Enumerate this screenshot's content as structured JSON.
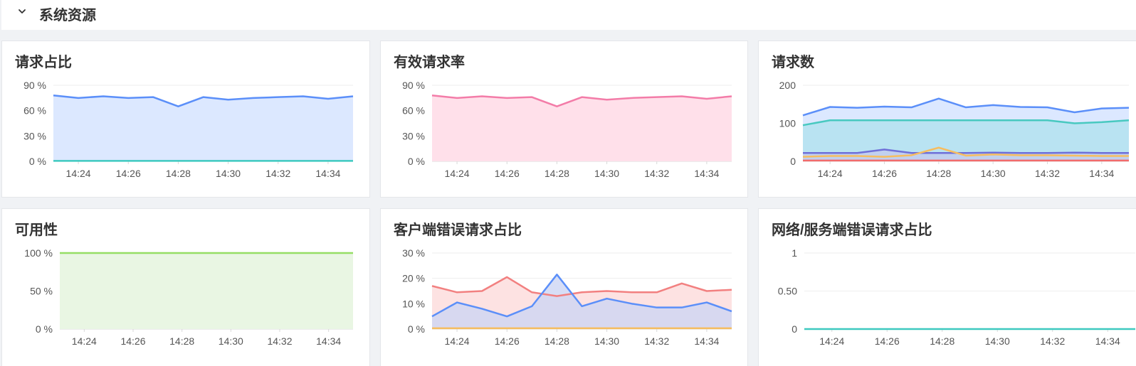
{
  "section": {
    "title": "系统资源"
  },
  "x_ticks": [
    "14:24",
    "14:26",
    "14:28",
    "14:30",
    "14:32",
    "14:34"
  ],
  "chart_data": [
    {
      "type": "area",
      "title": "请求占比",
      "y_ticks": [
        "90 %",
        "60 %",
        "30 %",
        "0 %"
      ],
      "ylim": [
        0,
        90
      ],
      "series": [
        {
          "color": "#5b8ff9",
          "fill": "#dce8ff",
          "fill_opacity": 1,
          "values": [
            78,
            75,
            77,
            75,
            76,
            65,
            76,
            73,
            75,
            76,
            77,
            74,
            77
          ]
        },
        {
          "color": "#3ec9c0",
          "fill": null,
          "values": [
            0.5,
            0.5,
            0.5,
            0.5,
            0.5,
            0.5,
            0.5,
            0.5,
            0.5,
            0.5,
            0.5,
            0.5,
            0.5
          ]
        }
      ]
    },
    {
      "type": "area",
      "title": "有效请求率",
      "y_ticks": [
        "90 %",
        "60 %",
        "30 %",
        "0 %"
      ],
      "ylim": [
        0,
        90
      ],
      "series": [
        {
          "color": "#f37ca8",
          "fill": "#ffe0ea",
          "fill_opacity": 1,
          "values": [
            78,
            75,
            77,
            75,
            76,
            65,
            76,
            73,
            75,
            76,
            77,
            74,
            77
          ]
        }
      ]
    },
    {
      "type": "area",
      "title": "请求数",
      "y_ticks": [
        "200",
        "100",
        "0"
      ],
      "ylim": [
        0,
        200
      ],
      "series": [
        {
          "color": "#5b8ff9",
          "fill": "#dce8ff",
          "fill_opacity": 1,
          "values": [
            121,
            143,
            141,
            144,
            142,
            165,
            142,
            148,
            143,
            142,
            129,
            139,
            141
          ]
        },
        {
          "color": "#48c9c0",
          "fill": "#b9e3f2",
          "fill_opacity": 1,
          "values": [
            95,
            108,
            108,
            108,
            108,
            108,
            108,
            108,
            108,
            108,
            100,
            103,
            108
          ]
        },
        {
          "color": "#6f6fd8",
          "fill": "#c4c8ee",
          "fill_opacity": 0.7,
          "values": [
            22,
            22,
            22,
            31,
            22,
            22,
            22,
            23,
            22,
            22,
            23,
            22,
            22
          ]
        },
        {
          "color": "#f6bd60",
          "fill": null,
          "values": [
            12,
            14,
            14,
            12,
            16,
            36,
            15,
            18,
            16,
            16,
            15,
            14,
            14
          ]
        },
        {
          "color": "#f26b6b",
          "fill": null,
          "values": [
            2,
            2,
            2,
            2,
            2,
            2,
            2,
            2,
            2,
            2,
            2,
            2,
            2
          ]
        }
      ]
    },
    {
      "type": "area",
      "title": "可用性",
      "y_ticks": [
        "100 %",
        "50 %",
        "0 %"
      ],
      "ylim": [
        0,
        100
      ],
      "series": [
        {
          "color": "#95de64",
          "fill": "#e9f6e3",
          "fill_opacity": 1,
          "values": [
            100,
            100,
            100,
            100,
            100,
            100,
            100,
            100,
            100,
            100,
            100,
            100,
            100
          ]
        }
      ]
    },
    {
      "type": "area",
      "title": "客户端错误请求占比",
      "y_ticks": [
        "30 %",
        "20 %",
        "10 %",
        "0 %"
      ],
      "ylim": [
        0,
        30
      ],
      "series": [
        {
          "color": "#f28080",
          "fill": "#fde2e2",
          "fill_opacity": 1,
          "values": [
            17,
            14.5,
            15,
            20.5,
            14.5,
            13,
            14.5,
            15,
            14.5,
            14.5,
            18,
            15,
            15.5
          ]
        },
        {
          "color": "#5b8ff9",
          "fill": "#cdd6f4",
          "fill_opacity": 0.8,
          "values": [
            5,
            10.5,
            8,
            5,
            9,
            21.5,
            9,
            12,
            10,
            8.5,
            8.5,
            10.5,
            7
          ]
        },
        {
          "color": "#f6bd60",
          "fill": null,
          "values": [
            0.3,
            0.3,
            0.3,
            0.3,
            0.3,
            0.3,
            0.3,
            0.3,
            0.3,
            0.3,
            0.3,
            0.3,
            0.3
          ]
        }
      ]
    },
    {
      "type": "line",
      "title": "网络/服务端错误请求占比",
      "y_ticks": [
        "1",
        "0.50",
        "0"
      ],
      "ylim": [
        0,
        1
      ],
      "series": [
        {
          "color": "#3ec9c0",
          "fill": null,
          "values": [
            0,
            0,
            0,
            0,
            0,
            0,
            0,
            0,
            0,
            0,
            0,
            0,
            0
          ]
        }
      ]
    }
  ]
}
